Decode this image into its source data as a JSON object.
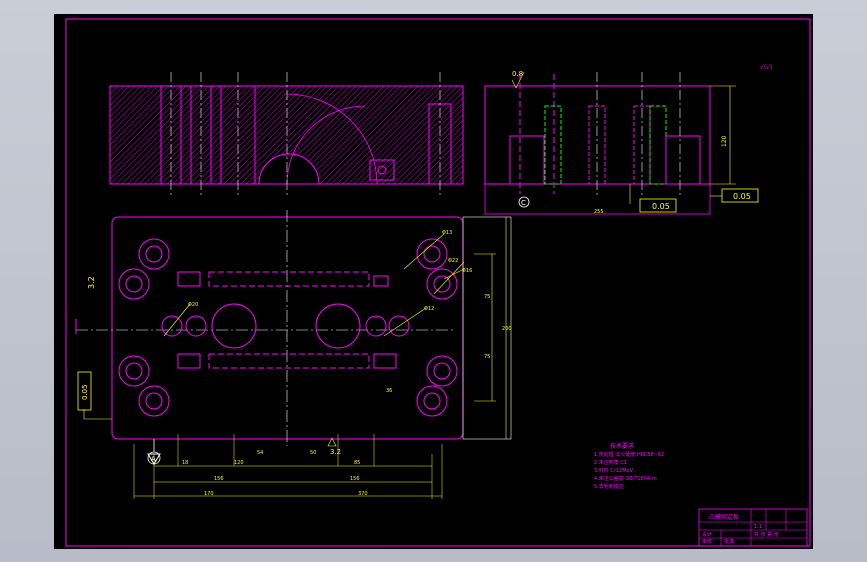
{
  "colors": {
    "background": "#000000",
    "outline": "#ff00ff",
    "dimension": "#ffff00",
    "centerline": "#ffffff",
    "hidden": "#00ff00"
  },
  "top_view": {
    "roughness_label": "3.2",
    "angle_label": "45°"
  },
  "side_view": {
    "roughness_label": "0.8",
    "height_label": "120",
    "width_label": "255",
    "tolerance_1": "0.05",
    "tolerance_2": "0.05",
    "datum_letter": "C"
  },
  "plan_view": {
    "surface_label": "3.2",
    "left_roughness": "3.2",
    "tolerance_left": "0.05",
    "datum_letter": "A",
    "holes": [
      "Φ20",
      "Φ13",
      "Φ22",
      "Φ12",
      "Φ16"
    ],
    "dims_right": [
      "75",
      "200",
      "35"
    ],
    "dims_bottom_1": [
      "18",
      "120",
      "54",
      "50",
      "85"
    ],
    "dims_bottom_2": [
      "156",
      "156"
    ],
    "dims_bottom_3": [
      "170",
      "370"
    ],
    "dim_side": "36"
  },
  "corner_mark": "√(√)",
  "notes": {
    "heading": "技术要求",
    "lines": [
      "1.热处理 淬火硬度 HRC58~62",
      "2.未注倒角 C1",
      "3.材料 Cr12MoV",
      "4.未注公差按 GB/T1804-m",
      "5.去毛刺锐边"
    ]
  },
  "title_block": {
    "name": "凸模固定板",
    "scale": "1:1",
    "sheet": "共 张 第 张",
    "rows": [
      "设计",
      "审核",
      "批准"
    ]
  }
}
